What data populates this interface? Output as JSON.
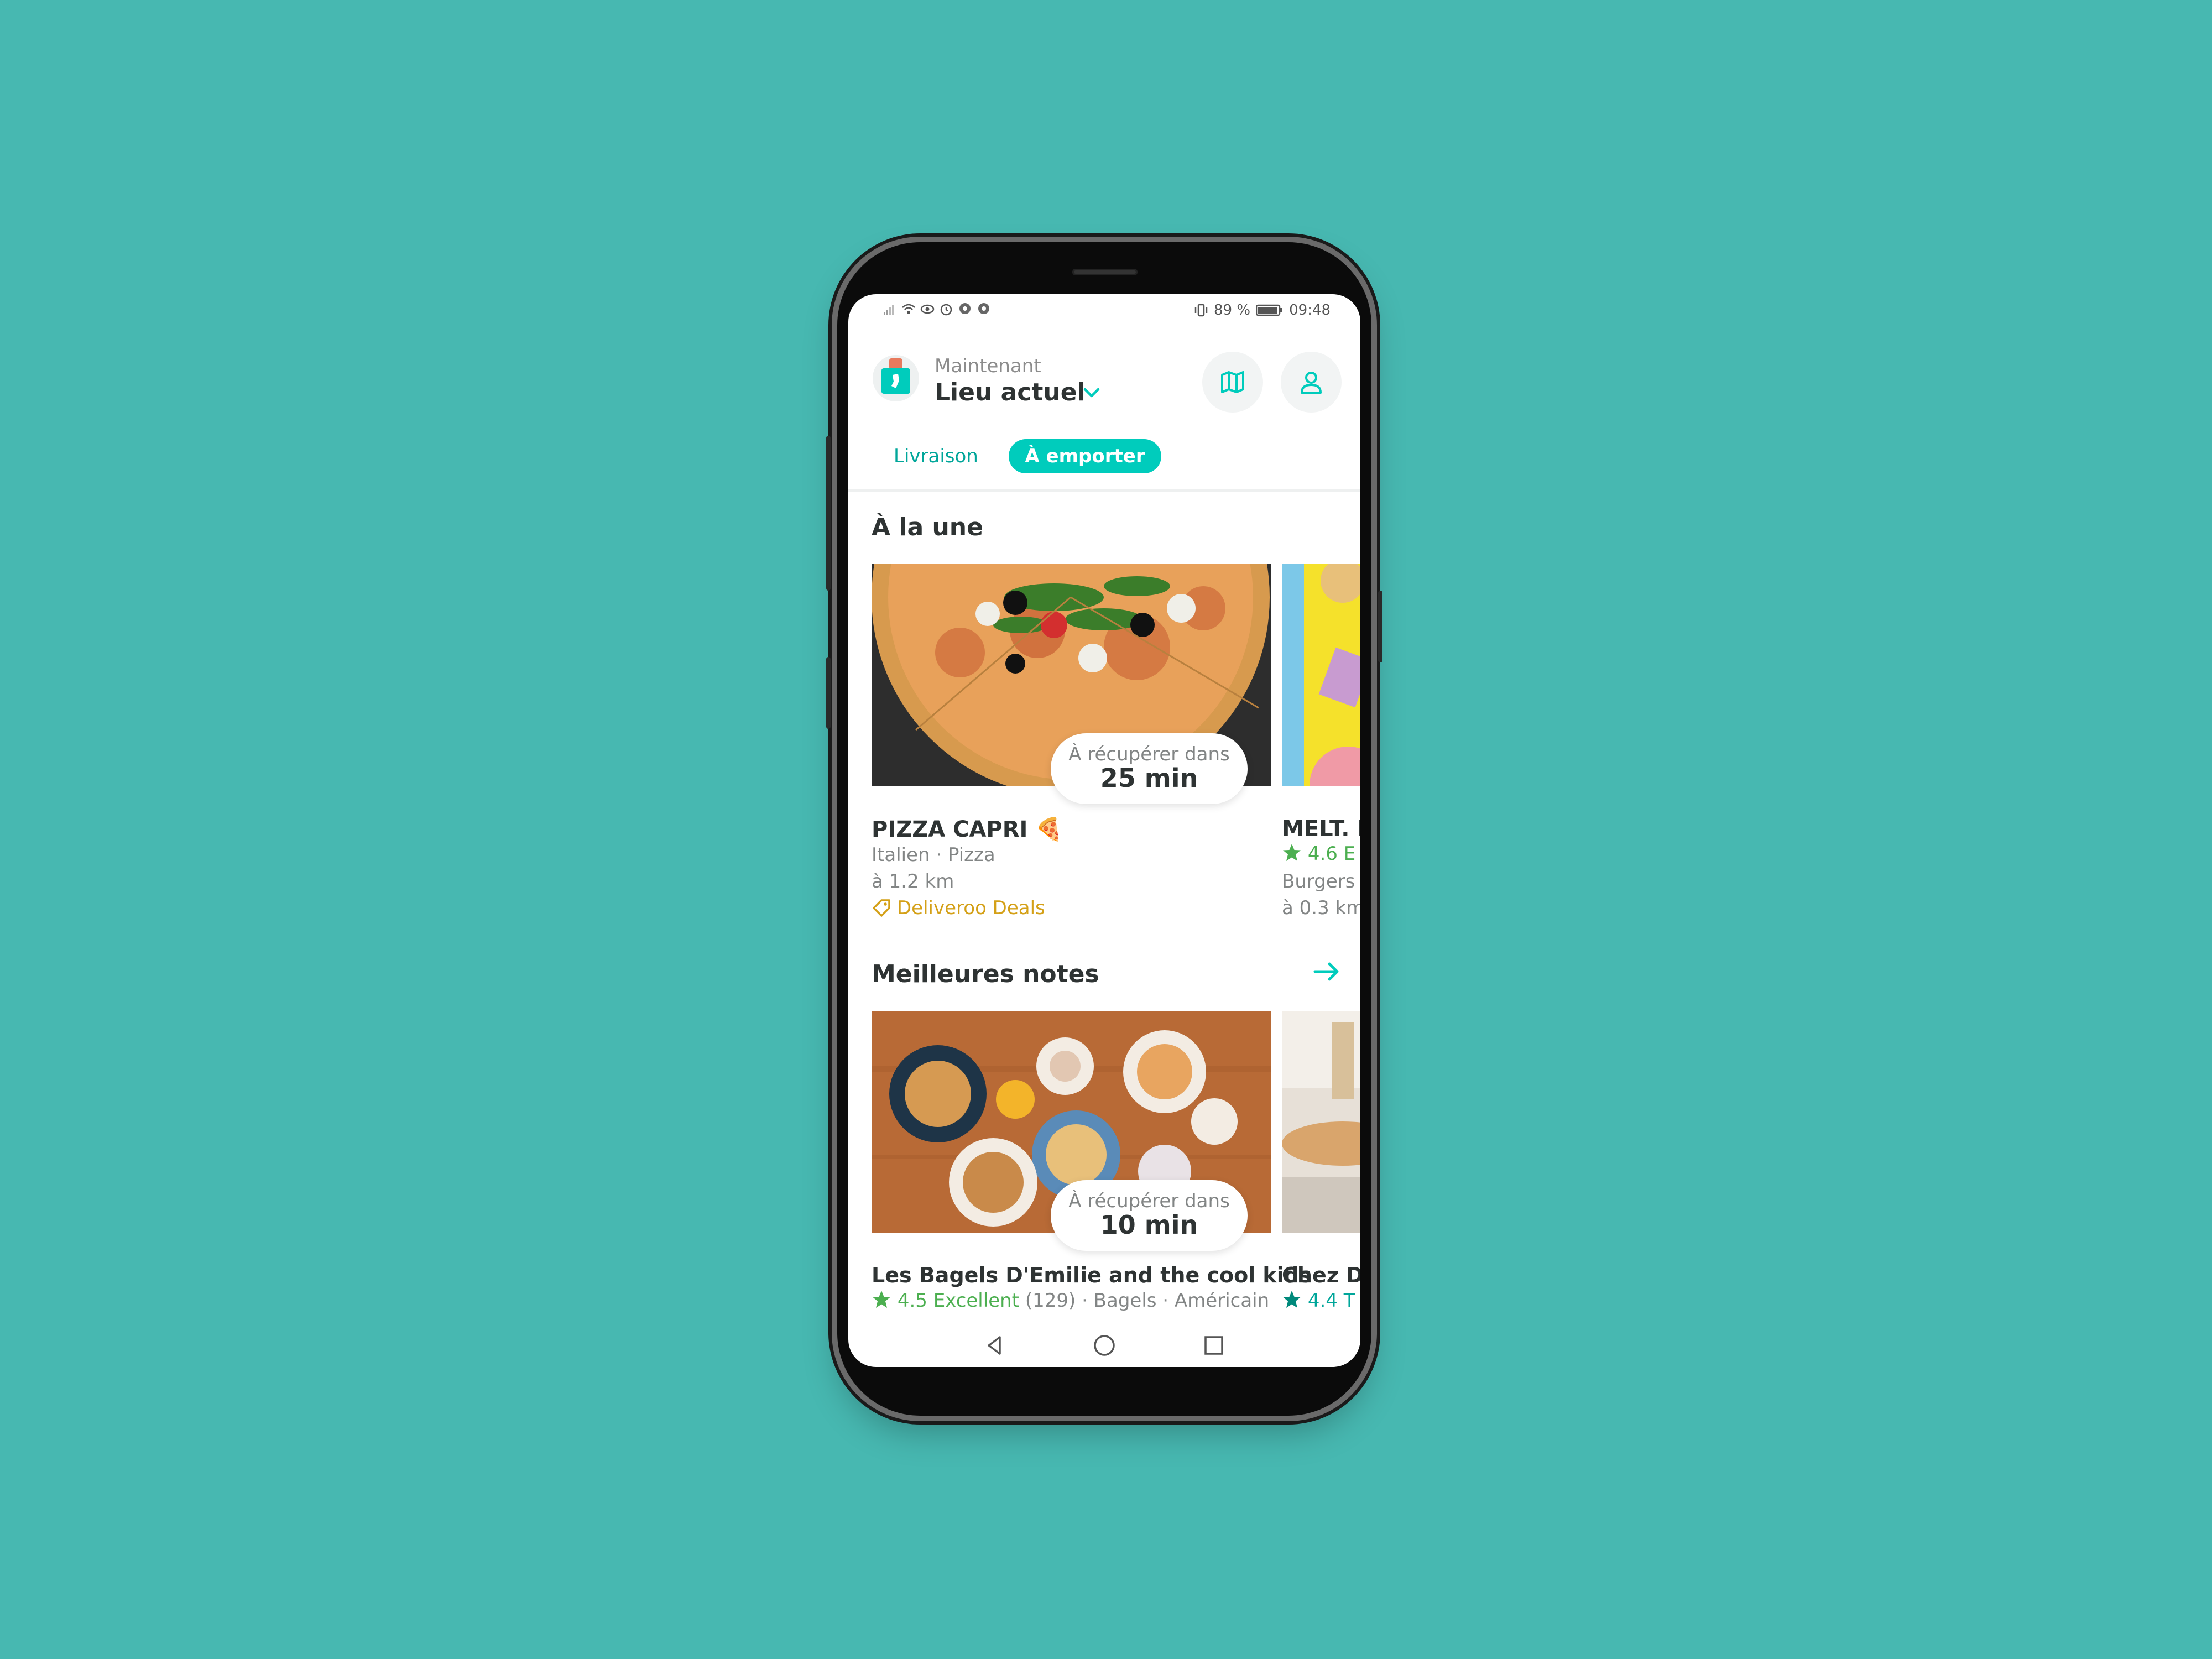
{
  "status": {
    "battery_pct": "89 %",
    "time": "09:48"
  },
  "header": {
    "subtitle": "Maintenant",
    "location": "Lieu actuel",
    "map_icon": "map-icon",
    "profile_icon": "user-icon"
  },
  "tabs": {
    "delivery": "Livraison",
    "pickup": "À emporter"
  },
  "featured": {
    "title": "À la une",
    "main": {
      "pill_label": "À récupérer dans",
      "pill_time": "25 min",
      "name": "PIZZA CAPRI 🍕",
      "cuisine": "Italien · Pizza",
      "distance": "à 1.2 km",
      "deal": "Deliveroo Deals"
    },
    "side": {
      "name": "MELT. H",
      "rating": "4.6 E",
      "cuisine": "Burgers ·",
      "distance": "à 0.3 km"
    }
  },
  "top_rated": {
    "title": "Meilleures notes",
    "main": {
      "pill_label": "À récupérer dans",
      "pill_time": "10 min",
      "name": "Les Bagels D'Emilie and the cool kids",
      "rating": "4.5 Excellent",
      "reviews": "(129)",
      "tags": "· Bagels · Américain"
    },
    "side": {
      "name": "Chez Di",
      "rating": "4.4 T"
    }
  },
  "colors": {
    "background": "#47b8b1",
    "accent": "#00ccbc",
    "deal": "#d4a017",
    "rating_green": "#4caf50"
  }
}
